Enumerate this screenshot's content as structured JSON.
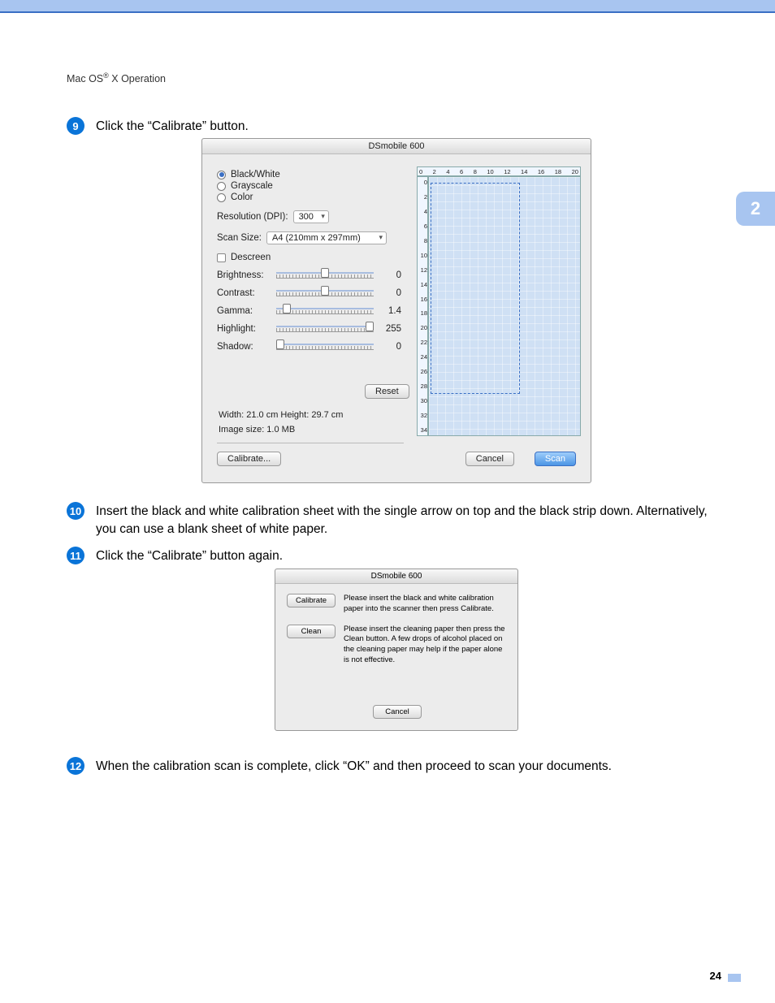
{
  "header": {
    "os_prefix": "Mac OS",
    "reg": "®",
    "os_suffix": " X Operation"
  },
  "side_tab": "2",
  "page_number": "24",
  "steps": {
    "s9": {
      "num": "9",
      "text": "Click the “Calibrate” button."
    },
    "s10": {
      "num": "10",
      "text": "Insert the black and white calibration sheet with the single arrow on top and the black strip down. Alternatively, you can use a blank sheet of white paper."
    },
    "s11": {
      "num": "11",
      "text": "Click the “Calibrate” button again."
    },
    "s12": {
      "num": "12",
      "text": "When the calibration scan is complete, click “OK” and then proceed to scan your documents."
    }
  },
  "shot1": {
    "title": "DSmobile 600",
    "radio_bw": "Black/White",
    "radio_gray": "Grayscale",
    "radio_color": "Color",
    "res_label": "Resolution (DPI):",
    "res_value": "300",
    "size_label": "Scan Size:",
    "size_value": "A4 (210mm x 297mm)",
    "descreen": "Descreen",
    "brightness_label": "Brightness:",
    "brightness_val": "0",
    "contrast_label": "Contrast:",
    "contrast_val": "0",
    "gamma_label": "Gamma:",
    "gamma_val": "1.4",
    "highlight_label": "Highlight:",
    "highlight_val": "255",
    "shadow_label": "Shadow:",
    "shadow_val": "0",
    "reset": "Reset",
    "width_height": "Width: 21.0 cm   Height: 29.7 cm",
    "image_size": "Image size: 1.0 MB",
    "calibrate": "Calibrate...",
    "cancel": "Cancel",
    "scan": "Scan",
    "ruler_h": [
      "0",
      "2",
      "4",
      "6",
      "8",
      "10",
      "12",
      "14",
      "16",
      "18",
      "20"
    ],
    "ruler_v": [
      "0",
      "2",
      "4",
      "6",
      "8",
      "10",
      "12",
      "14",
      "16",
      "18",
      "20",
      "22",
      "24",
      "26",
      "28",
      "30",
      "32",
      "34"
    ]
  },
  "shot2": {
    "title": "DSmobile 600",
    "calibrate_btn": "Calibrate",
    "calibrate_text": "Please insert the black and white calibration paper into the scanner then press Calibrate.",
    "clean_btn": "Clean",
    "clean_text": "Please insert the cleaning paper then press the Clean button. A few drops of alcohol placed on the cleaning paper may help if the paper alone is not effective.",
    "cancel": "Cancel"
  }
}
